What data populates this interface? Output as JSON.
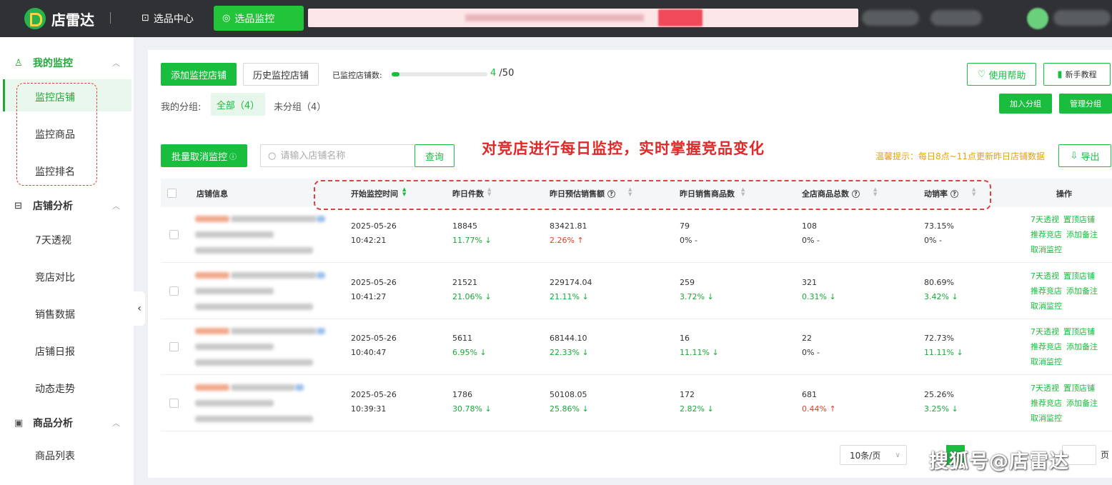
{
  "topbar": {
    "logo_text": "店雷达",
    "nav": [
      {
        "label": "选品中心"
      },
      {
        "label": "选品监控"
      }
    ]
  },
  "sidebar": {
    "sections": [
      {
        "title": "我的监控",
        "items": [
          "监控店铺",
          "监控商品",
          "监控排名"
        ]
      },
      {
        "title": "店铺分析",
        "items": [
          "7天透视",
          "竞店对比",
          "销售数据",
          "店铺日报",
          "动态走势"
        ]
      },
      {
        "title": "商品分析",
        "items": [
          "商品列表"
        ]
      }
    ]
  },
  "toolbar": {
    "add_button": "添加监控店铺",
    "history_button": "历史监控店铺",
    "progress_label": "已监控店铺数:",
    "progress_current": "4",
    "progress_total": " /50",
    "progress_fraction": 0.08,
    "help_button": "使用帮助",
    "tutorial_button": "新手教程",
    "join_group_button": "加入分组",
    "manage_group_button": "管理分组",
    "group_label": "我的分组:",
    "group_all": "全部（4）",
    "group_none": "未分组（4）"
  },
  "headline": "对竞店进行每日监控，实时掌握竞品变化",
  "search": {
    "batch_button": "批量取消监控",
    "placeholder": "请输入店铺名称",
    "query_button": "查询",
    "tip": "温馨提示：每日8点~11点更新昨日店铺数据",
    "export_button": "导出"
  },
  "table": {
    "headers": {
      "shop": "店铺信息",
      "start": "开始监控时间",
      "items": "昨日件数",
      "sales": "昨日预估销售额",
      "goods": "昨日销售商品数",
      "total": "全店商品总数",
      "rate": "动销率",
      "ops": "操作"
    },
    "rows": [
      {
        "date": "2025-05-26",
        "time": "10:42:21",
        "items": "18845",
        "items_chg": "11.77% ↓",
        "items_dir": "down",
        "sales": "83421.81",
        "sales_chg": "2.26% ↑",
        "sales_dir": "up",
        "goods": "79",
        "goods_chg": "0%   -",
        "goods_dir": "flat",
        "total": "108",
        "total_chg": "0%   -",
        "total_dir": "flat",
        "rate": "73.15%",
        "rate_chg": "0%   -",
        "rate_dir": "flat"
      },
      {
        "date": "2025-05-26",
        "time": "10:41:27",
        "items": "21521",
        "items_chg": "21.06% ↓",
        "items_dir": "down",
        "sales": "229174.04",
        "sales_chg": "21.11% ↓",
        "sales_dir": "down",
        "goods": "259",
        "goods_chg": "3.72% ↓",
        "goods_dir": "down",
        "total": "321",
        "total_chg": "0.31% ↓",
        "total_dir": "down",
        "rate": "80.69%",
        "rate_chg": "3.42% ↓",
        "rate_dir": "down"
      },
      {
        "date": "2025-05-26",
        "time": "10:40:47",
        "items": "5611",
        "items_chg": "6.95% ↓",
        "items_dir": "down",
        "sales": "68144.10",
        "sales_chg": "22.33% ↓",
        "sales_dir": "down",
        "goods": "16",
        "goods_chg": "11.11% ↓",
        "goods_dir": "down",
        "total": "22",
        "total_chg": "0%   -",
        "total_dir": "flat",
        "rate": "72.73%",
        "rate_chg": "11.11% ↓",
        "rate_dir": "down"
      },
      {
        "date": "2025-05-26",
        "time": "10:39:31",
        "items": "1786",
        "items_chg": "30.78% ↓",
        "items_dir": "down",
        "sales": "50108.05",
        "sales_chg": "25.86% ↓",
        "sales_dir": "down",
        "goods": "172",
        "goods_chg": "2.82% ↓",
        "goods_dir": "down",
        "total": "681",
        "total_chg": "0.44% ↑",
        "total_dir": "up",
        "rate": "25.26%",
        "rate_chg": "3.25% ↓",
        "rate_dir": "down"
      }
    ],
    "ops": {
      "view7": "7天透视",
      "pin": "置顶店铺",
      "recommend": "推荐竞店",
      "note": "添加备注",
      "cancel": "取消监控"
    }
  },
  "pagination": {
    "page_size": "10条/页",
    "current_page": "1",
    "page_suffix": "页"
  },
  "watermark": "搜狐号@店雷达",
  "colors": {
    "brand": "#19be3f",
    "topbar": "#2f3134",
    "tip": "#e8a20c",
    "annotation": "#e02828"
  }
}
